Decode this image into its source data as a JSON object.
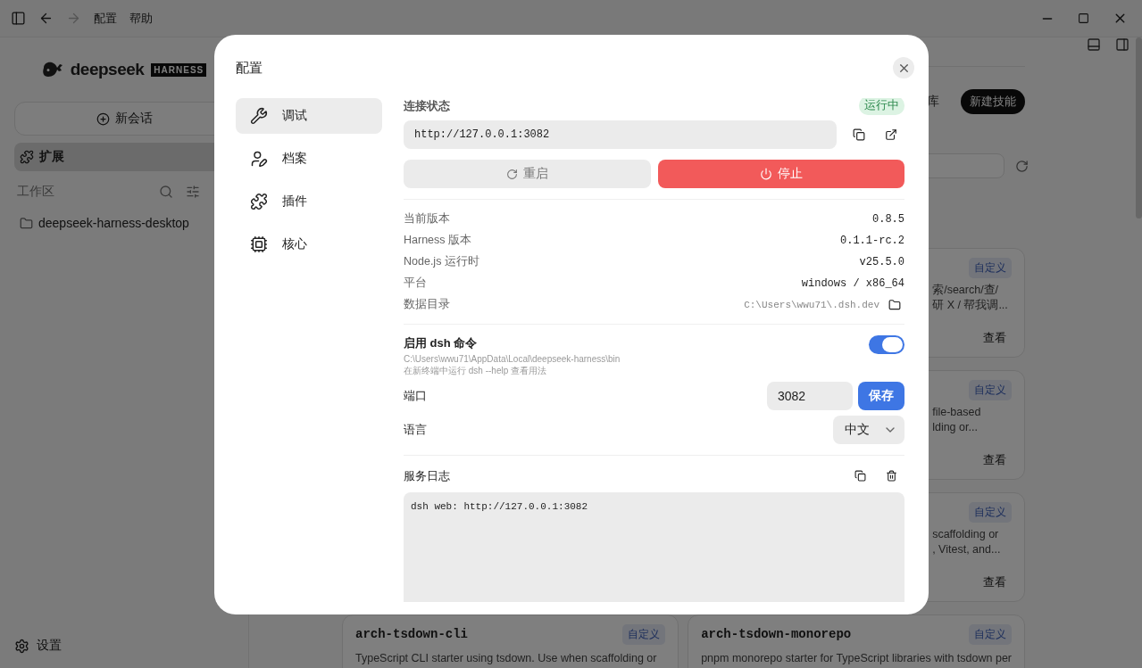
{
  "titlebar": {
    "history": [
      {
        "disabled": false
      },
      {
        "disabled": true
      }
    ],
    "menus": [
      "配置",
      "帮助"
    ]
  },
  "sidebar": {
    "logo": "deepseek",
    "logo_badge": "HARNESS",
    "new_chat": "新会话",
    "nav": [
      {
        "label": "扩展",
        "selected": true
      }
    ],
    "workspace_label": "工作区",
    "folders": [
      "deepseek-harness-desktop"
    ],
    "settings": "设置"
  },
  "main": {
    "tab_fragment": "库",
    "new_skill": "新建技能",
    "cards": [
      {
        "badge": "自定义",
        "desc_lines": [
          "索/search/查/",
          "研 X / 帮我调..."
        ],
        "action": "查看"
      },
      {
        "badge": "自定义",
        "desc_lines": [
          "file-based",
          "lding or..."
        ],
        "action": "查看"
      },
      {
        "badge": "自定义",
        "desc_lines": [
          "scaffolding or",
          ", Vitest, and..."
        ],
        "action": "查看"
      }
    ],
    "bottom_cards": [
      {
        "title": "arch-tsdown-cli",
        "badge": "自定义",
        "desc": "TypeScript CLI starter using tsdown. Use when scaffolding or"
      },
      {
        "title": "arch-tsdown-monorepo",
        "badge": "自定义",
        "desc": "pnpm monorepo starter for TypeScript libraries with tsdown per"
      }
    ]
  },
  "dialog": {
    "title": "配置",
    "nav": [
      {
        "label": "调试",
        "selected": true
      },
      {
        "label": "档案",
        "selected": false
      },
      {
        "label": "插件",
        "selected": false
      },
      {
        "label": "核心",
        "selected": false
      }
    ],
    "status": {
      "label": "连接状态",
      "badge": "运行中",
      "url": "http://127.0.0.1:3082",
      "restart": "重启",
      "stop": "停止"
    },
    "info": [
      {
        "label": "当前版本",
        "value": "0.8.5",
        "kind": "value"
      },
      {
        "label": "Harness 版本",
        "value": "0.1.1-rc.2",
        "kind": "value"
      },
      {
        "label": "Node.js 运行时",
        "value": "v25.5.0",
        "kind": "value"
      },
      {
        "label": "平台",
        "value": "windows / x86_64",
        "kind": "value"
      },
      {
        "label": "数据目录",
        "value": "C:\\Users\\wwu71\\.dsh.dev",
        "kind": "path"
      }
    ],
    "cli": {
      "label": "启用 dsh 命令",
      "path": "C:\\Users\\wwu71\\AppData\\Local\\deepseek-harness\\bin",
      "hint": "在新终端中运行 dsh --help 查看用法",
      "on": true
    },
    "port": {
      "label": "端口",
      "value": "3082",
      "save": "保存"
    },
    "language": {
      "label": "语言",
      "value": "中文"
    },
    "log": {
      "label": "服务日志",
      "lines": [
        "dsh web: http://127.0.0.1:3082"
      ]
    }
  }
}
